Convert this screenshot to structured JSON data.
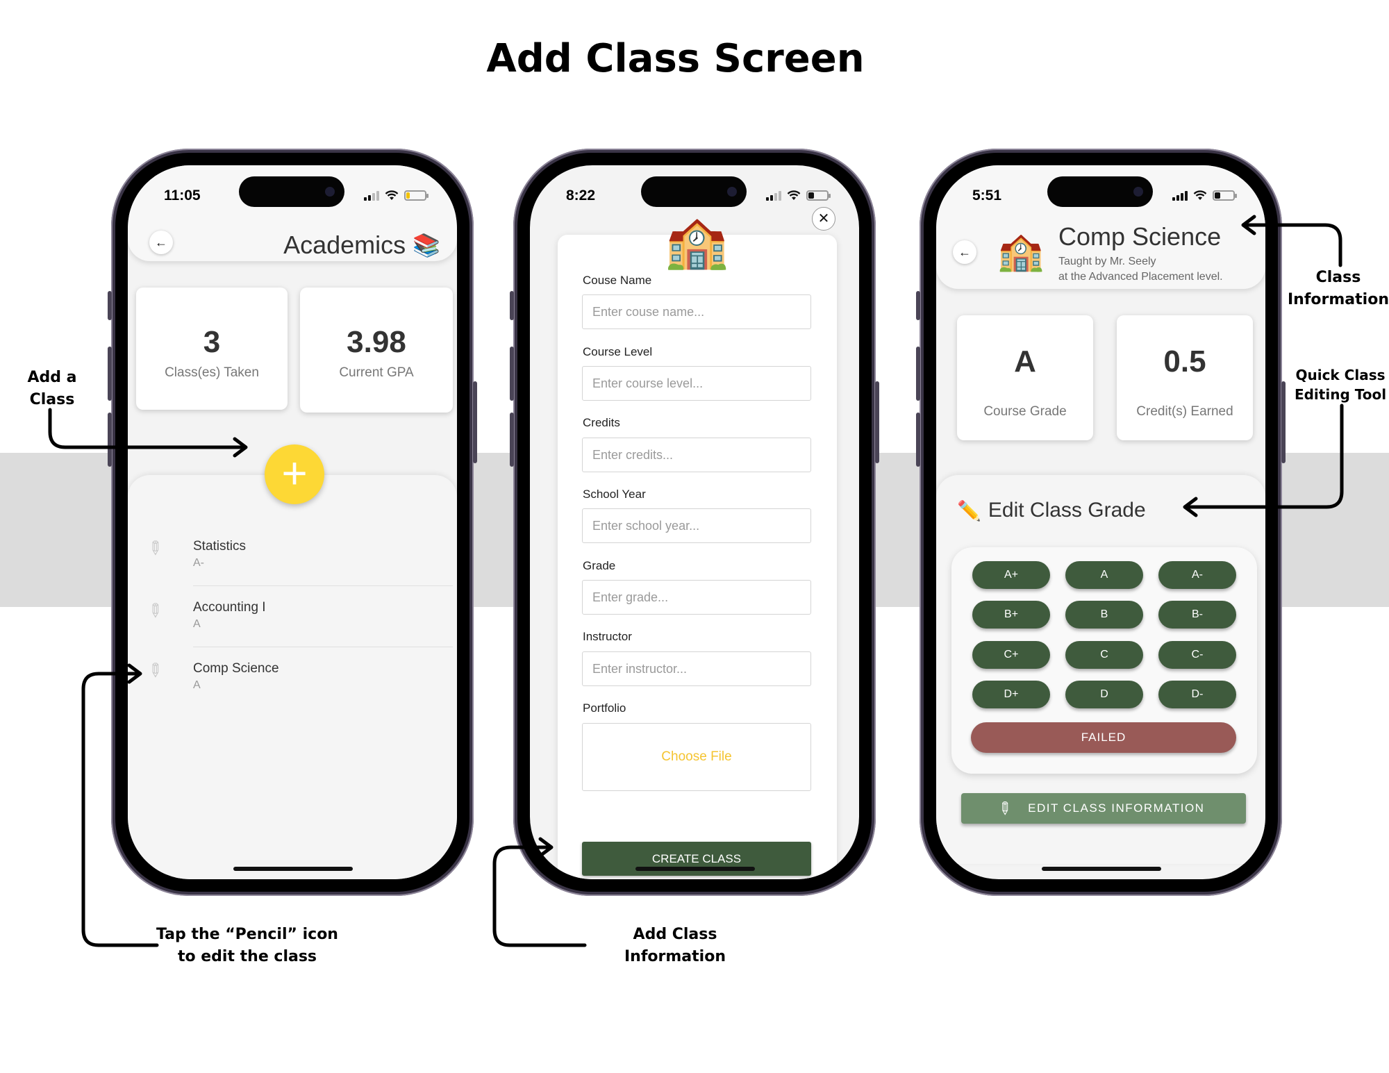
{
  "page_title": "Add Class Screen",
  "phone1": {
    "time": "11:05",
    "title": "Academics",
    "title_emoji": "📚",
    "stats": [
      {
        "value": "3",
        "label": "Class(es) Taken"
      },
      {
        "value": "3.98",
        "label": "Current GPA"
      }
    ],
    "add_icon": "+",
    "classes": [
      {
        "name": "Statistics",
        "grade": "A-"
      },
      {
        "name": "Accounting I",
        "grade": "A"
      },
      {
        "name": "Comp Science",
        "grade": "A"
      }
    ]
  },
  "phone2": {
    "time": "8:22",
    "emoji": "🏫",
    "close_icon": "✕",
    "fields": [
      {
        "label": "Couse Name",
        "placeholder": "Enter couse name..."
      },
      {
        "label": "Course Level",
        "placeholder": "Enter course level..."
      },
      {
        "label": "Credits",
        "placeholder": "Enter credits..."
      },
      {
        "label": "School Year",
        "placeholder": "Enter school year..."
      },
      {
        "label": "Grade",
        "placeholder": "Enter grade..."
      },
      {
        "label": "Instructor",
        "placeholder": "Enter instructor..."
      }
    ],
    "portfolio_label": "Portfolio",
    "choose_file": "Choose File",
    "create_button": "CREATE CLASS"
  },
  "phone3": {
    "time": "5:51",
    "emoji": "🏫",
    "class_name": "Comp Science",
    "taught_by": "Taught by Mr. Seely",
    "level_text": "at the Advanced Placement level.",
    "stats": [
      {
        "value": "A",
        "label": "Course Grade"
      },
      {
        "value": "0.5",
        "label": "Credit(s) Earned"
      }
    ],
    "edit_emoji": "✏️",
    "edit_title": "Edit Class Grade",
    "grades": [
      [
        "A+",
        "A",
        "A-"
      ],
      [
        "B+",
        "B",
        "B-"
      ],
      [
        "C+",
        "C",
        "C-"
      ],
      [
        "D+",
        "D",
        "D-"
      ]
    ],
    "failed": "FAILED",
    "edit_info_button": "EDIT CLASS INFORMATION"
  },
  "annotations": {
    "add_class": [
      "Add a",
      "Class"
    ],
    "pencil": [
      "Tap the “Pencil” icon",
      "to edit the class"
    ],
    "add_info": [
      "Add Class",
      "Information"
    ],
    "class_info": [
      "Class",
      "Information"
    ],
    "quick_edit": [
      "Quick Class",
      "Editing Tool"
    ]
  },
  "colors": {
    "accent_yellow": "#fdd835",
    "dark_green": "#3f5b3d",
    "muted_green": "#6f8f6d",
    "failed_red": "#995a57",
    "band_gray": "#dcdcdc"
  }
}
